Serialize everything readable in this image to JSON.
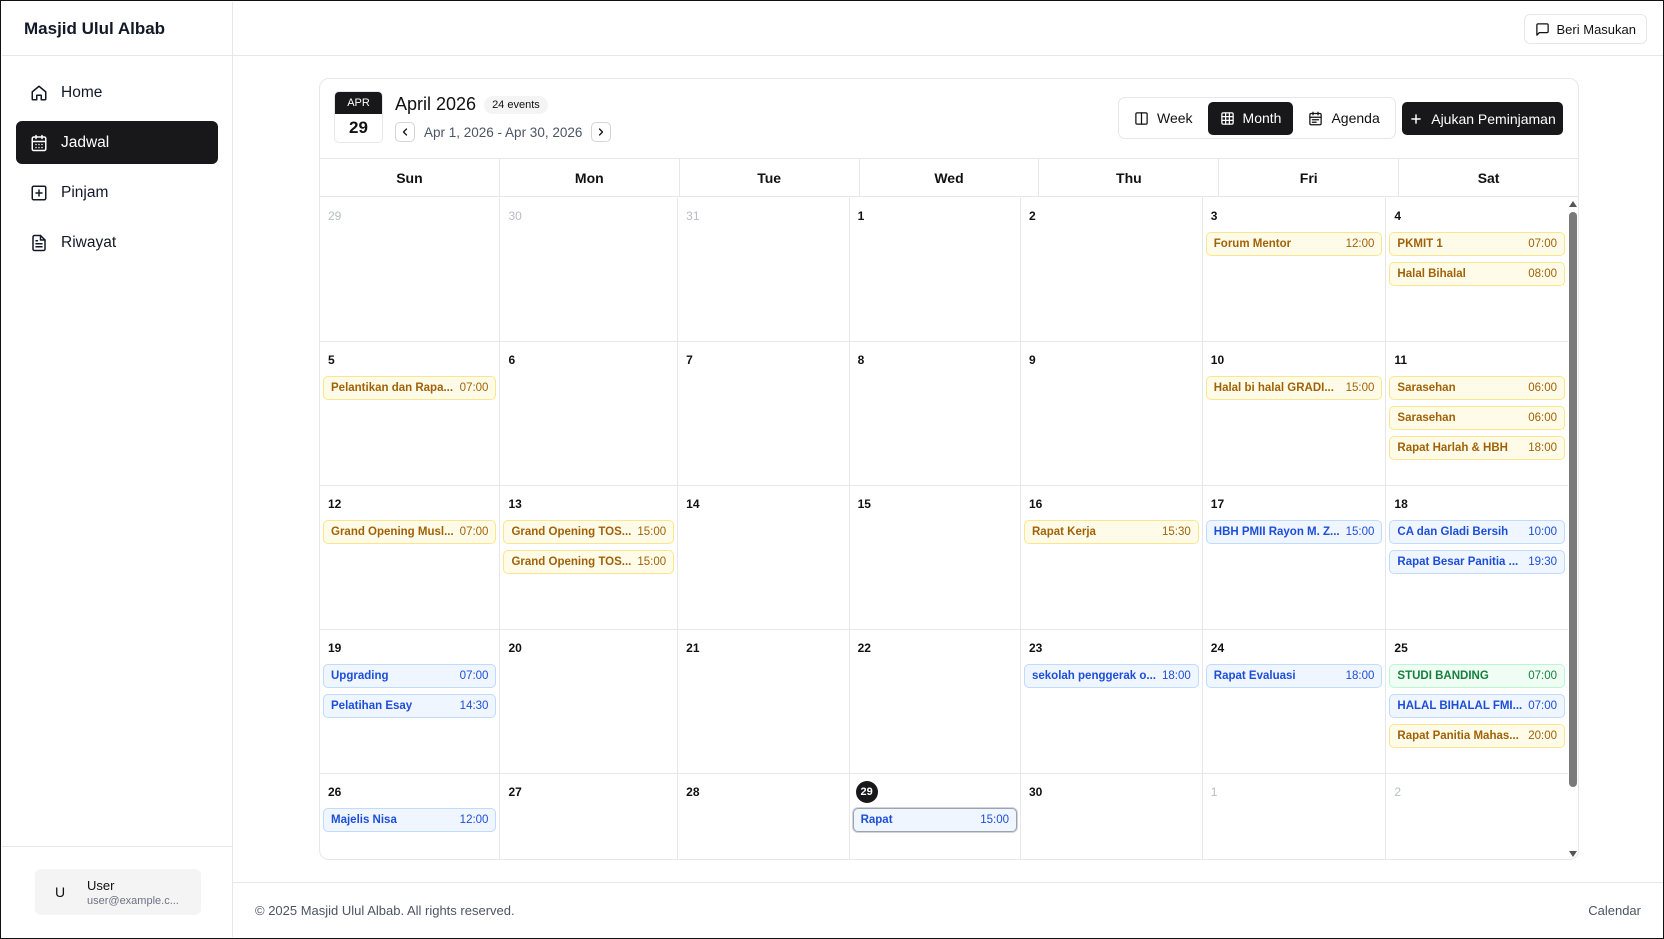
{
  "app": {
    "title": "Masjid Ulul Albab"
  },
  "sidebar": {
    "items": [
      {
        "label": "Home",
        "icon": "home-icon",
        "active": false
      },
      {
        "label": "Jadwal",
        "icon": "calendar-icon",
        "active": true
      },
      {
        "label": "Pinjam",
        "icon": "plus-square-icon",
        "active": false
      },
      {
        "label": "Riwayat",
        "icon": "file-text-icon",
        "active": false
      }
    ],
    "user": {
      "initial": "U",
      "name": "User",
      "email": "user@example.c..."
    }
  },
  "topbar": {
    "feedback_label": "Beri Masukan"
  },
  "calendar": {
    "badge_month": "APR",
    "badge_day": "29",
    "title": "April 2026",
    "event_count": "24 events",
    "range": "Apr 1, 2026 - Apr 30, 2026",
    "views": [
      {
        "label": "Week",
        "icon": "columns-icon",
        "active": false
      },
      {
        "label": "Month",
        "icon": "grid-icon",
        "active": true
      },
      {
        "label": "Agenda",
        "icon": "calendar-list-icon",
        "active": false
      }
    ],
    "submit_label": "Ajukan Peminjaman",
    "weekdays": [
      "Sun",
      "Mon",
      "Tue",
      "Wed",
      "Thu",
      "Fri",
      "Sat"
    ],
    "weeks": [
      [
        {
          "day": "29",
          "outside": true,
          "events": []
        },
        {
          "day": "30",
          "outside": true,
          "events": []
        },
        {
          "day": "31",
          "outside": true,
          "events": []
        },
        {
          "day": "1",
          "events": []
        },
        {
          "day": "2",
          "events": []
        },
        {
          "day": "3",
          "events": [
            {
              "title": "Forum Mentor",
              "time": "12:00",
              "color": "yellow"
            }
          ]
        },
        {
          "day": "4",
          "events": [
            {
              "title": "PKMIT 1",
              "time": "07:00",
              "color": "yellow"
            },
            {
              "title": "Halal Bihalal",
              "time": "08:00",
              "color": "yellow"
            }
          ]
        }
      ],
      [
        {
          "day": "5",
          "events": [
            {
              "title": "Pelantikan dan Rapa...",
              "time": "07:00",
              "color": "yellow"
            }
          ]
        },
        {
          "day": "6",
          "events": []
        },
        {
          "day": "7",
          "events": []
        },
        {
          "day": "8",
          "events": []
        },
        {
          "day": "9",
          "events": []
        },
        {
          "day": "10",
          "events": [
            {
              "title": "Halal bi halal GRADI...",
              "time": "15:00",
              "color": "yellow"
            }
          ]
        },
        {
          "day": "11",
          "events": [
            {
              "title": "Sarasehan",
              "time": "06:00",
              "color": "yellow"
            },
            {
              "title": "Sarasehan",
              "time": "06:00",
              "color": "yellow"
            },
            {
              "title": "Rapat Harlah & HBH",
              "time": "18:00",
              "color": "yellow"
            }
          ]
        }
      ],
      [
        {
          "day": "12",
          "events": [
            {
              "title": "Grand Opening Musl...",
              "time": "07:00",
              "color": "yellow"
            }
          ]
        },
        {
          "day": "13",
          "events": [
            {
              "title": "Grand Opening TOS...",
              "time": "15:00",
              "color": "yellow"
            },
            {
              "title": "Grand Opening TOS...",
              "time": "15:00",
              "color": "yellow"
            }
          ]
        },
        {
          "day": "14",
          "events": []
        },
        {
          "day": "15",
          "events": []
        },
        {
          "day": "16",
          "events": [
            {
              "title": "Rapat Kerja",
              "time": "15:30",
              "color": "yellow"
            }
          ]
        },
        {
          "day": "17",
          "events": [
            {
              "title": "HBH PMII Rayon M. Z...",
              "time": "15:00",
              "color": "blue"
            }
          ]
        },
        {
          "day": "18",
          "events": [
            {
              "title": "CA dan Gladi Bersih",
              "time": "10:00",
              "color": "blue"
            },
            {
              "title": "Rapat Besar Panitia ...",
              "time": "19:30",
              "color": "blue"
            }
          ]
        }
      ],
      [
        {
          "day": "19",
          "events": [
            {
              "title": "Upgrading",
              "time": "07:00",
              "color": "blue"
            },
            {
              "title": "Pelatihan Esay",
              "time": "14:30",
              "color": "blue"
            }
          ]
        },
        {
          "day": "20",
          "events": []
        },
        {
          "day": "21",
          "events": []
        },
        {
          "day": "22",
          "events": []
        },
        {
          "day": "23",
          "events": [
            {
              "title": "sekolah penggerak o...",
              "time": "18:00",
              "color": "blue"
            }
          ]
        },
        {
          "day": "24",
          "events": [
            {
              "title": "Rapat Evaluasi",
              "time": "18:00",
              "color": "blue"
            }
          ]
        },
        {
          "day": "25",
          "events": [
            {
              "title": "STUDI BANDING",
              "time": "07:00",
              "color": "green"
            },
            {
              "title": "HALAL BIHALAL FMI...",
              "time": "07:00",
              "color": "blue"
            },
            {
              "title": "Rapat Panitia Mahas...",
              "time": "20:00",
              "color": "yellow"
            }
          ]
        }
      ],
      [
        {
          "day": "26",
          "events": [
            {
              "title": "Majelis Nisa",
              "time": "12:00",
              "color": "blue"
            }
          ]
        },
        {
          "day": "27",
          "events": []
        },
        {
          "day": "28",
          "events": []
        },
        {
          "day": "29",
          "today": true,
          "events": [
            {
              "title": "Rapat",
              "time": "15:00",
              "color": "blue",
              "selected": true
            }
          ]
        },
        {
          "day": "30",
          "events": []
        },
        {
          "day": "1",
          "outside": true,
          "events": []
        },
        {
          "day": "2",
          "outside": true,
          "events": []
        }
      ]
    ]
  },
  "footer": {
    "copyright": "© 2025 Masjid Ulul Albab. All rights reserved.",
    "right_label": "Calendar"
  }
}
